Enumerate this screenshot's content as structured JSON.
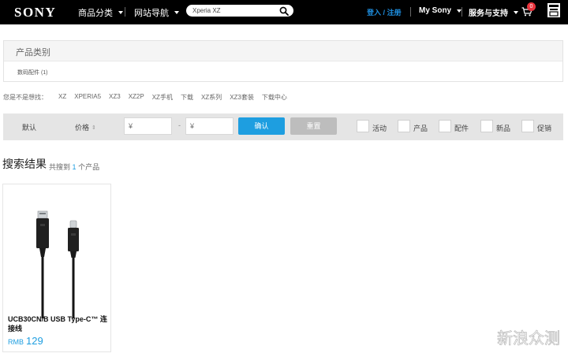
{
  "header": {
    "logo": "SONY",
    "nav": [
      {
        "label": "商品分类"
      },
      {
        "label": "网站导航"
      }
    ],
    "search": {
      "value": "Xperia XZ",
      "icon": "search-icon"
    },
    "login": "登入",
    "login_sep": "/",
    "register": "注册",
    "mysony": "My Sony",
    "support": "服务与支持",
    "cart_count": "0",
    "accent_color": "#1e8fe0"
  },
  "category": {
    "title": "产品类别",
    "item": "数码配件 (1)"
  },
  "suggest": {
    "lead": "您是不是想找：",
    "keywords": [
      "XZ",
      "XPERIA5",
      "XZ3",
      "XZ2P",
      "XZ手机",
      "下载",
      "XZ系列",
      "XZ3套装",
      "下载中心"
    ]
  },
  "filter": {
    "default_label": "默认",
    "price_label": "价格",
    "price_min_placeholder": "¥",
    "price_max_placeholder": "¥",
    "dash": "-",
    "confirm": "确认",
    "reset": "重置",
    "checkboxes": [
      "活动",
      "产品",
      "配件",
      "新品",
      "促销"
    ]
  },
  "results": {
    "title": "搜索结果",
    "count_prefix": "共搜到",
    "count": "1",
    "count_suffix": "个产品"
  },
  "product": {
    "name": "UCB30CN/B USB Type-C™ 连接线",
    "currency": "RMB",
    "price": "129"
  },
  "watermark": {
    "text": "新浪众测"
  }
}
